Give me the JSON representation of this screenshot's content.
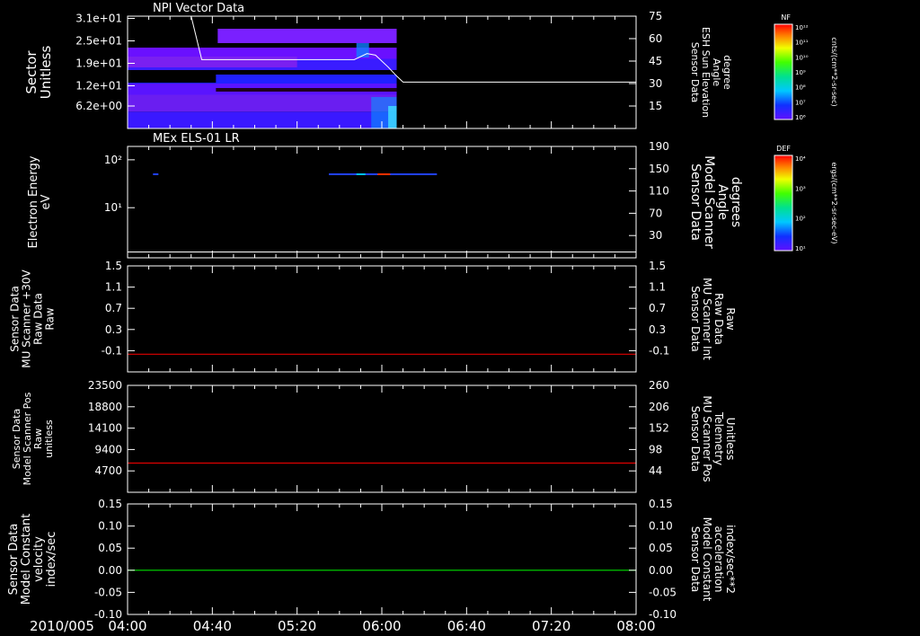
{
  "date_label": "2010/005",
  "time_ticks": [
    "04:00",
    "04:40",
    "05:20",
    "06:00",
    "06:40",
    "07:20",
    "08:00"
  ],
  "colors": {
    "white": "#ffffff",
    "red": "#e00000",
    "green": "#00e000"
  },
  "chart_data": [
    {
      "id": "npi",
      "type": "heatmap",
      "title": "NPI Vector Data",
      "ylabel_left": [
        "Sector",
        "Unitless"
      ],
      "yticks_left": [
        "3.1e+01",
        "2.5e+01",
        "1.9e+01",
        "1.2e+01",
        "6.2e+00"
      ],
      "ylabel_right": [
        "Sensor Data",
        "ESH Sun Elevation",
        "Angle",
        "degree"
      ],
      "yticks_right": [
        "75",
        "60",
        "45",
        "30",
        "15"
      ],
      "ylim_right": [
        0,
        75
      ],
      "line_series": {
        "name": "ESH Sun Elevation Angle",
        "color": "#ffffff",
        "x": [
          "04:00",
          "04:30",
          "04:35",
          "05:47",
          "05:53",
          "05:57",
          "06:03",
          "06:07",
          "06:10",
          "08:00"
        ],
        "y": [
          75,
          75,
          46,
          46,
          50,
          49,
          41,
          35,
          31,
          31
        ]
      },
      "colorbar": {
        "label": "NF",
        "units": "cnts/(cm**2-sr-sec)",
        "ticks": [
          "10¹²",
          "10¹¹",
          "10¹⁰",
          "10⁹",
          "10⁸",
          "10⁷",
          "10⁶"
        ]
      },
      "data_extent": [
        "04:00",
        "06:07"
      ]
    },
    {
      "id": "els",
      "type": "heatmap",
      "title": "MEx ELS-01 LR",
      "ylabel_left": [
        "Electron Energy",
        "eV"
      ],
      "yticks_left": [
        "10²",
        "10¹"
      ],
      "ylabel_right": [
        "Sensor Data",
        "Model Scanner",
        "Angle",
        "degrees"
      ],
      "yticks_right": [
        "190",
        "150",
        "110",
        "70",
        "30"
      ],
      "ylim_right": [
        0,
        190
      ],
      "line_series": {
        "name": "Model Scanner Angle",
        "color": "#ffffff",
        "x": [
          "04:00",
          "08:00"
        ],
        "y": [
          10,
          10
        ]
      },
      "colorbar": {
        "label": "DEF",
        "units": "ergs/(cm**2-sr-sec-eV)",
        "ticks": [
          "10⁴",
          "10³",
          "10²",
          "10¹"
        ]
      }
    },
    {
      "id": "mu-int",
      "type": "line",
      "ylabel_left": [
        "Sensor Data",
        "MU Scanner +30V",
        "Raw Data",
        "Raw"
      ],
      "yticks_left": [
        "1.5",
        "1.1",
        "0.7",
        "0.3",
        "-0.1"
      ],
      "ylabel_right": [
        "Sensor Data",
        "MU Scanner Int",
        "Raw Data",
        "Raw"
      ],
      "yticks_right": [
        "1.5",
        "1.1",
        "0.7",
        "0.3",
        "-0.1"
      ],
      "ylim": [
        -0.3,
        1.5
      ],
      "series": [
        {
          "color": "#e00000",
          "x": [
            "04:00",
            "08:00"
          ],
          "y": [
            0,
            0
          ]
        }
      ]
    },
    {
      "id": "mu-pos",
      "type": "line",
      "ylabel_left": [
        "Sensor Data",
        "Model Scanner Pos",
        "Raw",
        "unitless"
      ],
      "yticks_left": [
        "23500",
        "18800",
        "14100",
        "9400",
        "4700"
      ],
      "ylabel_right": [
        "Sensor Data",
        "MU Scanner Pos",
        "Telemetry",
        "Unitless"
      ],
      "yticks_right": [
        "260",
        "206",
        "152",
        "98",
        "44"
      ],
      "ylim_left": [
        0,
        23500
      ],
      "ylim_right": [
        0,
        260
      ],
      "series": [
        {
          "color": "#e00000",
          "x": [
            "04:00",
            "08:00"
          ],
          "y_right": [
            71,
            71
          ]
        }
      ]
    },
    {
      "id": "constant",
      "type": "line",
      "ylabel_left": [
        "Sensor Data",
        "Model Constant",
        "velocity",
        "index/sec"
      ],
      "yticks_left": [
        "0.15",
        "0.10",
        "0.05",
        "0.00",
        "-0.05",
        "-0.10"
      ],
      "ylabel_right": [
        "Sensor Data",
        "Model Constant",
        "acceleration",
        "index/sec**2"
      ],
      "yticks_right": [
        "0.15",
        "0.10",
        "0.05",
        "0.00",
        "-0.05",
        "-0.10"
      ],
      "ylim": [
        -0.1,
        0.15
      ],
      "series": [
        {
          "color": "#00e000",
          "x": [
            "04:00",
            "08:00"
          ],
          "y": [
            0,
            0
          ]
        }
      ]
    }
  ]
}
